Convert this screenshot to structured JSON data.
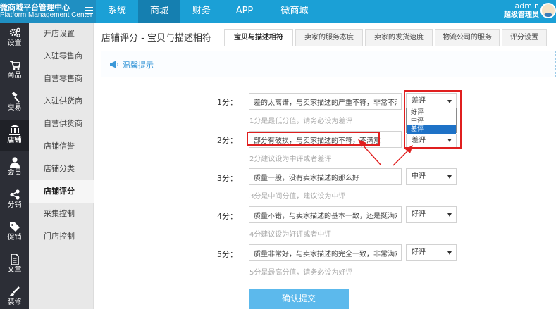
{
  "brand": {
    "title_cn": "微商城平台管理中心",
    "title_en": "Platform Management Center"
  },
  "topnav": [
    {
      "label": "系统",
      "active": false
    },
    {
      "label": "商城",
      "active": true
    },
    {
      "label": "财务",
      "active": false
    },
    {
      "label": "APP",
      "active": false
    },
    {
      "label": "微商城",
      "active": false
    }
  ],
  "user": {
    "name": "admin",
    "role": "超级管理员"
  },
  "leftbar": [
    {
      "label": "设置",
      "icon": "gears-icon",
      "active": false
    },
    {
      "label": "商品",
      "icon": "cart-icon",
      "active": false
    },
    {
      "label": "交易",
      "icon": "gavel-icon",
      "active": false
    },
    {
      "label": "店铺",
      "icon": "bank-icon",
      "active": true
    },
    {
      "label": "会员",
      "icon": "user-icon",
      "active": false
    },
    {
      "label": "分销",
      "icon": "share-icon",
      "active": false
    },
    {
      "label": "促销",
      "icon": "tag-icon",
      "active": false
    },
    {
      "label": "文章",
      "icon": "document-icon",
      "active": false
    },
    {
      "label": "装修",
      "icon": "brush-icon",
      "active": false
    }
  ],
  "subnav": [
    {
      "label": "开店设置",
      "active": false
    },
    {
      "label": "入驻零售商",
      "active": false
    },
    {
      "label": "自营零售商",
      "active": false
    },
    {
      "label": "入驻供货商",
      "active": false
    },
    {
      "label": "自营供货商",
      "active": false
    },
    {
      "label": "店铺信誉",
      "active": false
    },
    {
      "label": "店铺分类",
      "active": false
    },
    {
      "label": "店铺评分",
      "active": true
    },
    {
      "label": "采集控制",
      "active": false
    },
    {
      "label": "门店控制",
      "active": false
    }
  ],
  "page": {
    "title": "店铺评分 - 宝贝与描述相符"
  },
  "tabs": [
    {
      "label": "宝贝与描述相符",
      "active": true
    },
    {
      "label": "卖家的服务态度",
      "active": false
    },
    {
      "label": "卖家的发货速度",
      "active": false
    },
    {
      "label": "物流公司的服务",
      "active": false
    },
    {
      "label": "评分设置",
      "active": false
    }
  ],
  "notice": {
    "text": "温馨提示"
  },
  "rows": [
    {
      "label": "1分：",
      "desc": "差的太离谱，与卖家描述的严重不符，非常不满",
      "select": "差评",
      "hint": "1分是最低分值，请务必设为差评"
    },
    {
      "label": "2分：",
      "desc": "部分有破损，与卖家描述的不符，不满意",
      "select": "差评",
      "hint": "2分建议设为中评或者差评"
    },
    {
      "label": "3分：",
      "desc": "质量一般，没有卖家描述的那么好",
      "select": "中评",
      "hint": "3分是中间分值，建议设为中评"
    },
    {
      "label": "4分：",
      "desc": "质量不错，与卖家描述的基本一致，还是挺满意的",
      "select": "好评",
      "hint": "4分建议设为好评或者中评"
    },
    {
      "label": "5分：",
      "desc": "质量非常好，与卖家描述的完全一致，非常满意",
      "select": "好评",
      "hint": "5分是最高分值，请务必设为好评"
    }
  ],
  "dropdown": {
    "options": [
      {
        "label": "好评",
        "active": false
      },
      {
        "label": "中评",
        "active": false
      },
      {
        "label": "差评",
        "active": true
      }
    ]
  },
  "submit": {
    "label": "确认提交"
  },
  "colors": {
    "topbar": "#1ba0d6",
    "sidebar": "#2c2e36",
    "accent": "#5cb9ec",
    "annotation": "#e01f1f"
  }
}
